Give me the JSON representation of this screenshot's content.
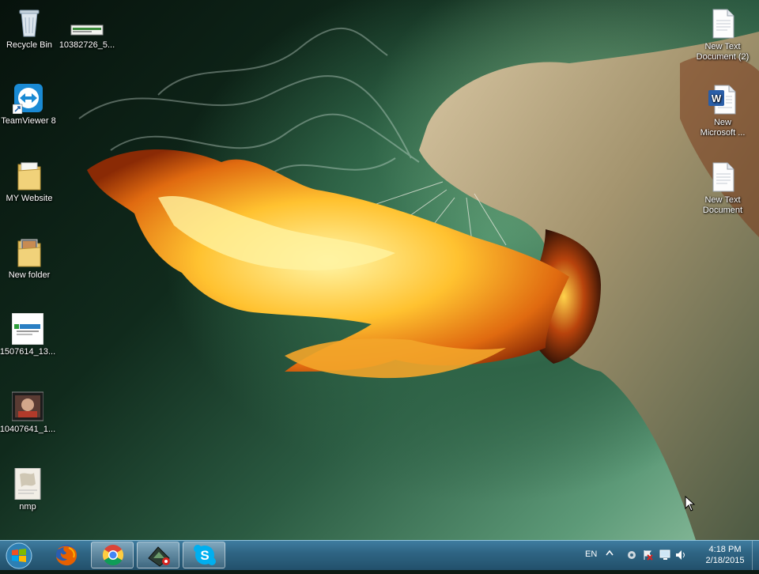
{
  "desktop": {
    "icons_left": [
      {
        "label": "Recycle Bin",
        "icon": "recycle-bin-icon"
      },
      {
        "label": "10382726_5...",
        "icon": "image-file-icon"
      },
      {
        "label": "TeamViewer 8",
        "icon": "teamviewer-icon"
      },
      {
        "label": "MY Website",
        "icon": "folder-icon"
      },
      {
        "label": "New folder",
        "icon": "folder-icon"
      },
      {
        "label": "1507614_13...",
        "icon": "image-file-icon"
      },
      {
        "label": "10407641_1...",
        "icon": "image-file-icon"
      },
      {
        "label": "nmp",
        "icon": "image-file-icon"
      }
    ],
    "icons_right": [
      {
        "label_line1": "New Text",
        "label_line2": "Document (2)",
        "icon": "text-document-icon"
      },
      {
        "label_line1": "New",
        "label_line2": "Microsoft ...",
        "icon": "word-document-icon"
      },
      {
        "label_line1": "New Text",
        "label_line2": "Document",
        "icon": "text-document-icon"
      }
    ]
  },
  "taskbar": {
    "start_button": "windows-start-icon",
    "pinned": [
      {
        "name": "firefox",
        "icon": "firefox-icon"
      },
      {
        "name": "chrome",
        "icon": "chrome-icon",
        "active": true
      },
      {
        "name": "recorder",
        "icon": "screen-recorder-icon",
        "active": true
      },
      {
        "name": "skype",
        "icon": "skype-icon",
        "active": true
      }
    ],
    "tray": {
      "language": "EN",
      "time": "4:18 PM",
      "date": "2/18/2015"
    }
  },
  "colors": {
    "taskbar": "#2f6584",
    "accent": "#1a8ad4"
  }
}
